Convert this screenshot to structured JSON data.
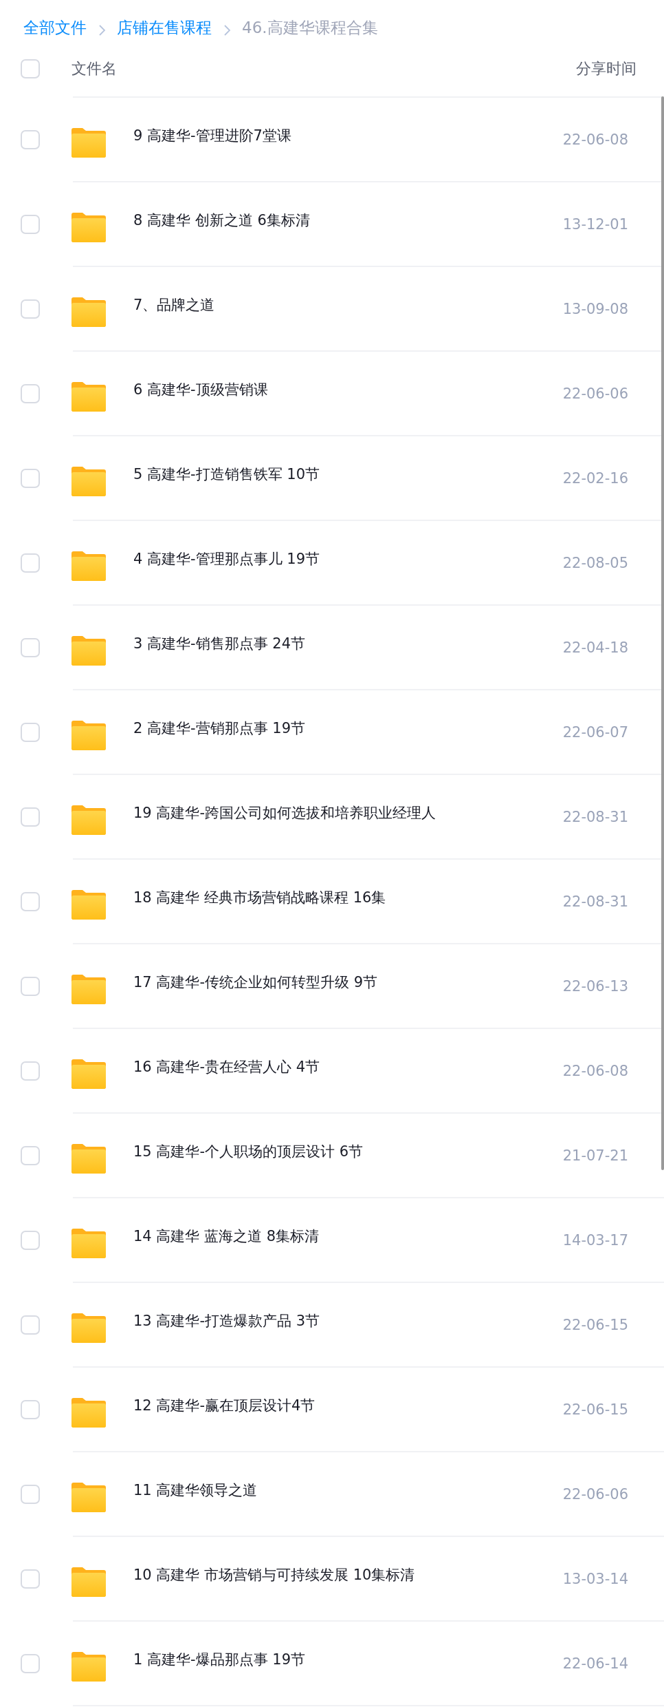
{
  "breadcrumb": [
    {
      "label": "全部文件",
      "kind": "link"
    },
    {
      "label": "店铺在售课程",
      "kind": "link"
    },
    {
      "label": "46.高建华课程合集",
      "kind": "current"
    }
  ],
  "header": {
    "select_all_checked": false,
    "name": "文件名",
    "time": "分享时间"
  },
  "rows": [
    {
      "name": "9 高建华-管理进阶7堂课",
      "date": "22-06-08",
      "checked": false
    },
    {
      "name": "8 高建华 创新之道 6集标清",
      "date": "13-12-01",
      "checked": false
    },
    {
      "name": "7、品牌之道",
      "date": "13-09-08",
      "checked": false
    },
    {
      "name": "6 高建华-顶级营销课",
      "date": "22-06-06",
      "checked": false
    },
    {
      "name": "5 高建华-打造销售铁军 10节",
      "date": "22-02-16",
      "checked": false
    },
    {
      "name": "4 高建华-管理那点事儿 19节",
      "date": "22-08-05",
      "checked": false
    },
    {
      "name": "3 高建华-销售那点事 24节",
      "date": "22-04-18",
      "checked": false
    },
    {
      "name": "2 高建华-营销那点事 19节",
      "date": "22-06-07",
      "checked": false
    },
    {
      "name": "19 高建华-跨国公司如何选拔和培养职业经理人",
      "date": "22-08-31",
      "checked": false
    },
    {
      "name": "18 高建华 经典市场营销战略课程 16集",
      "date": "22-08-31",
      "checked": false
    },
    {
      "name": "17 高建华-传统企业如何转型升级 9节",
      "date": "22-06-13",
      "checked": false
    },
    {
      "name": "16 高建华-贵在经营人心 4节",
      "date": "22-06-08",
      "checked": false
    },
    {
      "name": "15 高建华-个人职场的顶层设计 6节",
      "date": "21-07-21",
      "checked": false
    },
    {
      "name": "14 高建华 蓝海之道 8集标清",
      "date": "14-03-17",
      "checked": false
    },
    {
      "name": "13 高建华-打造爆款产品 3节",
      "date": "22-06-15",
      "checked": false
    },
    {
      "name": "12 高建华-赢在顶层设计4节",
      "date": "22-06-15",
      "checked": false
    },
    {
      "name": "11 高建华领导之道",
      "date": "22-06-06",
      "checked": false
    },
    {
      "name": "10 高建华 市场营销与可持续发展 10集标清",
      "date": "13-03-14",
      "checked": false
    },
    {
      "name": "1 高建华-爆品那点事 19节",
      "date": "22-06-14",
      "checked": false
    }
  ]
}
